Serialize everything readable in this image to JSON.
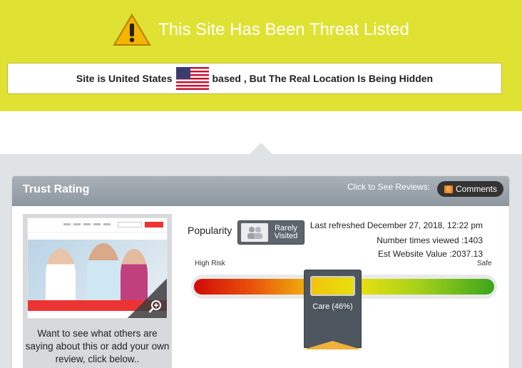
{
  "banner": {
    "title": "This Site Has Been Threat Listed",
    "location_prefix": "Site is United States",
    "location_suffix": "based , But The Real Location Is Being Hidden"
  },
  "panel": {
    "title": "Trust Rating",
    "reviews_hint": "Click to See Reviews:",
    "comments_count": "0",
    "comments_label": "Comments"
  },
  "thumbnail": {
    "caption": "Want to see what others are saying about this or add your own review, click below.."
  },
  "popularity": {
    "label": "Popularity",
    "status": "Rarely Visited"
  },
  "stats": {
    "last_refreshed": "Last refreshed December 27, 2018, 12:22 pm",
    "times_viewed": "Number times viewed :1403",
    "website_value": "Est Website Value :2037.13"
  },
  "risk": {
    "low_label": "High Risk",
    "high_label": "Safe",
    "marker_label": "Care (46%)",
    "value_percent": 46
  },
  "colors": {
    "banner": "#dfe233",
    "panel_header": "#99a2aa",
    "comment_badge": "#ef8a21"
  }
}
